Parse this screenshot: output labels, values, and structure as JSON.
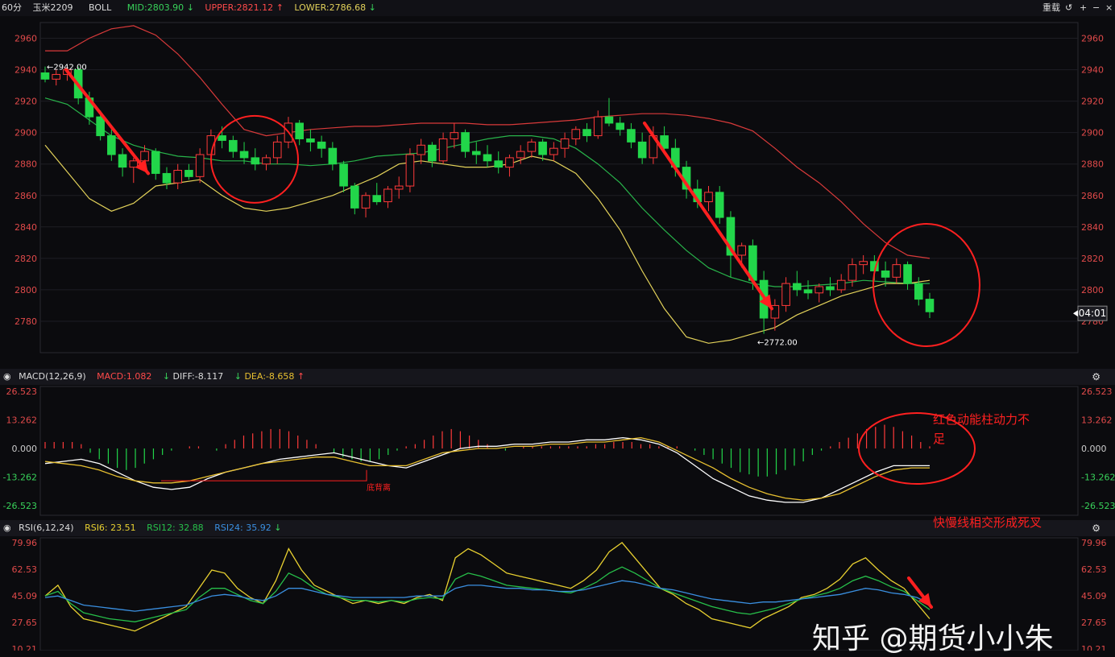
{
  "top_bar": {
    "period": "60分",
    "symbol": "玉米2209",
    "indicator": "BOLL",
    "mid": "MID:2803.90",
    "upper": "UPPER:2821.12",
    "lower": "LOWER:2786.68",
    "reset_label": "重载",
    "controls": [
      "↺",
      "+",
      "−",
      "×"
    ]
  },
  "macd_bar": {
    "title": "MACD(12,26,9)",
    "macd": "MACD:1.082",
    "diff": "DIFF:-8.117",
    "dea": "DEA:-8.658"
  },
  "rsi_bar": {
    "title": "RSI(6,12,24)",
    "rsi6": "RSI6: 23.51",
    "rsi12": "RSI12: 32.88",
    "rsi24": "RSI24: 35.92"
  },
  "annotations": {
    "high_label": "←2942.00",
    "low_label": "←2772.00",
    "price_tag": "04:01",
    "divergence": "底背离",
    "note_macd_line1": "红色动能柱动力不",
    "note_macd_line2": "足",
    "note_cross": "快慢线相交形成死叉",
    "watermark": "知乎 @期货小小朱"
  },
  "colors": {
    "up": "#ff3a3a",
    "down": "#22d64a",
    "upper_band": "#d93a3a",
    "mid_band": "#28b34a",
    "lower_band": "#e3d25a",
    "diff": "#ffffff",
    "dea": "#e8c030",
    "rsi6": "#e8d030",
    "rsi12": "#27c04a",
    "rsi24": "#3a8fe0",
    "annotation": "#ff2020"
  },
  "chart_data": [
    {
      "type": "candlestick",
      "ylim": [
        2760,
        2970
      ],
      "yticks": [
        2960,
        2940,
        2920,
        2900,
        2880,
        2860,
        2840,
        2820,
        2800,
        2780
      ],
      "ohlc": [
        [
          2938,
          2942,
          2932,
          2934
        ],
        [
          2934,
          2940,
          2930,
          2937
        ],
        [
          2937,
          2942,
          2933,
          2940
        ],
        [
          2940,
          2942,
          2918,
          2922
        ],
        [
          2922,
          2926,
          2905,
          2910
        ],
        [
          2910,
          2914,
          2895,
          2898
        ],
        [
          2898,
          2902,
          2882,
          2886
        ],
        [
          2886,
          2890,
          2872,
          2878
        ],
        [
          2878,
          2884,
          2868,
          2882
        ],
        [
          2882,
          2892,
          2876,
          2888
        ],
        [
          2888,
          2890,
          2870,
          2874
        ],
        [
          2874,
          2878,
          2864,
          2868
        ],
        [
          2868,
          2880,
          2864,
          2876
        ],
        [
          2876,
          2880,
          2870,
          2872
        ],
        [
          2872,
          2890,
          2868,
          2886
        ],
        [
          2886,
          2902,
          2882,
          2898
        ],
        [
          2898,
          2904,
          2890,
          2895
        ],
        [
          2895,
          2898,
          2884,
          2888
        ],
        [
          2888,
          2894,
          2880,
          2884
        ],
        [
          2884,
          2890,
          2876,
          2880
        ],
        [
          2880,
          2886,
          2876,
          2884
        ],
        [
          2884,
          2898,
          2880,
          2894
        ],
        [
          2894,
          2910,
          2890,
          2906
        ],
        [
          2906,
          2908,
          2892,
          2896
        ],
        [
          2896,
          2902,
          2888,
          2894
        ],
        [
          2894,
          2898,
          2884,
          2890
        ],
        [
          2890,
          2894,
          2876,
          2880
        ],
        [
          2880,
          2882,
          2862,
          2866
        ],
        [
          2866,
          2868,
          2848,
          2852
        ],
        [
          2852,
          2862,
          2846,
          2860
        ],
        [
          2860,
          2868,
          2854,
          2856
        ],
        [
          2856,
          2866,
          2852,
          2864
        ],
        [
          2864,
          2872,
          2858,
          2866
        ],
        [
          2866,
          2890,
          2862,
          2886
        ],
        [
          2886,
          2896,
          2880,
          2892
        ],
        [
          2892,
          2894,
          2878,
          2882
        ],
        [
          2882,
          2900,
          2880,
          2896
        ],
        [
          2896,
          2906,
          2890,
          2900
        ],
        [
          2900,
          2902,
          2884,
          2888
        ],
        [
          2888,
          2894,
          2880,
          2886
        ],
        [
          2886,
          2892,
          2878,
          2882
        ],
        [
          2882,
          2888,
          2874,
          2878
        ],
        [
          2878,
          2886,
          2872,
          2884
        ],
        [
          2884,
          2892,
          2880,
          2888
        ],
        [
          2888,
          2896,
          2884,
          2894
        ],
        [
          2894,
          2896,
          2882,
          2886
        ],
        [
          2886,
          2894,
          2882,
          2890
        ],
        [
          2890,
          2900,
          2884,
          2896
        ],
        [
          2896,
          2904,
          2892,
          2902
        ],
        [
          2902,
          2906,
          2894,
          2898
        ],
        [
          2898,
          2914,
          2896,
          2910
        ],
        [
          2910,
          2922,
          2904,
          2906
        ],
        [
          2906,
          2910,
          2898,
          2902
        ],
        [
          2902,
          2906,
          2890,
          2894
        ],
        [
          2894,
          2900,
          2880,
          2884
        ],
        [
          2884,
          2904,
          2880,
          2898
        ],
        [
          2898,
          2904,
          2886,
          2890
        ],
        [
          2890,
          2896,
          2872,
          2878
        ],
        [
          2878,
          2882,
          2858,
          2864
        ],
        [
          2864,
          2870,
          2852,
          2856
        ],
        [
          2856,
          2866,
          2850,
          2862
        ],
        [
          2862,
          2866,
          2842,
          2846
        ],
        [
          2846,
          2850,
          2808,
          2822
        ],
        [
          2822,
          2830,
          2814,
          2828
        ],
        [
          2828,
          2832,
          2800,
          2806
        ],
        [
          2806,
          2812,
          2772,
          2782
        ],
        [
          2782,
          2794,
          2774,
          2790
        ],
        [
          2790,
          2808,
          2786,
          2804
        ],
        [
          2804,
          2812,
          2796,
          2800
        ],
        [
          2800,
          2806,
          2794,
          2798
        ],
        [
          2798,
          2804,
          2792,
          2802
        ],
        [
          2802,
          2808,
          2796,
          2800
        ],
        [
          2800,
          2810,
          2798,
          2806
        ],
        [
          2806,
          2820,
          2802,
          2816
        ],
        [
          2816,
          2822,
          2810,
          2818
        ],
        [
          2818,
          2822,
          2806,
          2812
        ],
        [
          2812,
          2818,
          2802,
          2808
        ],
        [
          2808,
          2820,
          2804,
          2816
        ],
        [
          2816,
          2818,
          2800,
          2804
        ],
        [
          2804,
          2808,
          2790,
          2794
        ],
        [
          2794,
          2798,
          2782,
          2786
        ]
      ],
      "boll_upper": [
        2952,
        2952,
        2960,
        2966,
        2968,
        2962,
        2950,
        2935,
        2918,
        2902,
        2898,
        2900,
        2902,
        2903,
        2904,
        2904,
        2905,
        2906,
        2906,
        2906,
        2905,
        2905,
        2906,
        2907,
        2908,
        2910,
        2911,
        2912,
        2912,
        2911,
        2909,
        2906,
        2901,
        2890,
        2878,
        2868,
        2856,
        2842,
        2830,
        2822,
        2820
      ],
      "boll_mid": [
        2922,
        2918,
        2908,
        2898,
        2892,
        2888,
        2885,
        2884,
        2882,
        2882,
        2880,
        2880,
        2879,
        2880,
        2882,
        2885,
        2886,
        2887,
        2890,
        2893,
        2896,
        2898,
        2898,
        2896,
        2890,
        2880,
        2868,
        2852,
        2838,
        2825,
        2814,
        2808,
        2804,
        2802,
        2802,
        2803,
        2804,
        2806,
        2805,
        2804,
        2804
      ],
      "boll_lower": [
        2892,
        2875,
        2858,
        2850,
        2855,
        2866,
        2868,
        2870,
        2860,
        2852,
        2850,
        2852,
        2856,
        2860,
        2866,
        2872,
        2880,
        2882,
        2880,
        2878,
        2878,
        2880,
        2885,
        2882,
        2874,
        2858,
        2838,
        2812,
        2788,
        2770,
        2766,
        2768,
        2772,
        2776,
        2784,
        2790,
        2796,
        2800,
        2804,
        2804,
        2806
      ]
    },
    {
      "type": "macd",
      "ylim": [
        -26.523,
        26.523
      ],
      "yticks": [
        26.523,
        13.262,
        0.0,
        -13.262,
        -26.523
      ],
      "hist": [
        3,
        3,
        3,
        3,
        2,
        -2,
        -5,
        -7,
        -9,
        -10,
        -9,
        -7,
        -5,
        -3,
        -1,
        0,
        1,
        1,
        0,
        -1,
        2,
        4,
        6,
        7,
        8,
        9,
        9,
        8,
        6,
        4,
        2,
        0,
        -2,
        -4,
        -5,
        -6,
        -6,
        -5,
        -3,
        -1,
        1,
        2,
        4,
        6,
        8,
        9,
        8,
        6,
        4,
        2,
        0,
        -1,
        0,
        1,
        1,
        1,
        1,
        1,
        1,
        1,
        1,
        2,
        2,
        3,
        3,
        3,
        2,
        2,
        1,
        1,
        1,
        0,
        -1,
        -3,
        -5,
        -7,
        -9,
        -11,
        -12,
        -13,
        -13,
        -12,
        -10,
        -8,
        -6,
        -3,
        -1,
        1,
        3,
        5,
        7,
        9,
        10,
        11,
        10,
        8,
        6,
        3,
        1
      ],
      "diff": [
        -7,
        -6,
        -5,
        -7,
        -11,
        -15,
        -18,
        -19,
        -18,
        -14,
        -11,
        -9,
        -7,
        -5,
        -4,
        -3,
        -2,
        -4,
        -6,
        -8,
        -9,
        -6,
        -3,
        0,
        1,
        1,
        2,
        2,
        3,
        3,
        4,
        4,
        5,
        4,
        2,
        -2,
        -8,
        -14,
        -18,
        -22,
        -24,
        -25,
        -25,
        -23,
        -19,
        -15,
        -11,
        -8,
        -8,
        -8
      ],
      "dea": [
        -6,
        -7,
        -8,
        -10,
        -13,
        -15,
        -16,
        -16,
        -15,
        -13,
        -11,
        -9,
        -7,
        -6,
        -5,
        -4,
        -4,
        -6,
        -8,
        -8,
        -8,
        -5,
        -2,
        -1,
        0,
        0,
        1,
        1,
        2,
        2,
        3,
        3,
        4,
        5,
        3,
        -1,
        -5,
        -9,
        -14,
        -18,
        -21,
        -23,
        -24,
        -23,
        -21,
        -17,
        -13,
        -10,
        -9,
        -9
      ]
    },
    {
      "type": "line",
      "ylim": [
        10.21,
        79.96
      ],
      "yticks": [
        79.96,
        62.53,
        45.09,
        27.65,
        10.21
      ],
      "series": [
        {
          "name": "RSI6",
          "values": [
            45,
            52,
            38,
            30,
            28,
            26,
            24,
            22,
            26,
            30,
            34,
            38,
            50,
            62,
            60,
            50,
            44,
            40,
            55,
            76,
            62,
            52,
            48,
            44,
            40,
            42,
            40,
            42,
            40,
            44,
            46,
            42,
            70,
            76,
            72,
            66,
            60,
            58,
            56,
            54,
            52,
            50,
            55,
            62,
            74,
            80,
            70,
            60,
            50,
            46,
            40,
            36,
            30,
            28,
            26,
            24,
            30,
            34,
            38,
            44,
            46,
            50,
            56,
            66,
            70,
            62,
            55,
            50,
            40,
            30
          ]
        },
        {
          "name": "RSI12",
          "values": [
            45,
            48,
            40,
            34,
            32,
            30,
            29,
            28,
            30,
            32,
            34,
            36,
            44,
            50,
            50,
            46,
            42,
            40,
            48,
            60,
            56,
            50,
            46,
            44,
            42,
            42,
            41,
            42,
            41,
            43,
            44,
            43,
            56,
            60,
            58,
            55,
            52,
            51,
            50,
            49,
            48,
            47,
            50,
            54,
            60,
            64,
            60,
            55,
            50,
            47,
            44,
            41,
            38,
            36,
            34,
            33,
            35,
            37,
            40,
            43,
            45,
            47,
            50,
            55,
            58,
            55,
            51,
            48,
            42,
            36
          ]
        },
        {
          "name": "RSI24",
          "values": [
            44,
            45,
            42,
            39,
            38,
            37,
            36,
            35,
            36,
            37,
            38,
            39,
            42,
            45,
            46,
            45,
            43,
            42,
            45,
            50,
            50,
            48,
            46,
            45,
            44,
            44,
            44,
            44,
            44,
            45,
            45,
            45,
            50,
            52,
            52,
            51,
            50,
            50,
            49,
            49,
            48,
            48,
            49,
            51,
            53,
            55,
            54,
            52,
            50,
            49,
            47,
            45,
            43,
            42,
            41,
            40,
            41,
            41,
            42,
            43,
            44,
            45,
            46,
            48,
            50,
            49,
            47,
            46,
            44,
            40
          ]
        }
      ]
    }
  ]
}
